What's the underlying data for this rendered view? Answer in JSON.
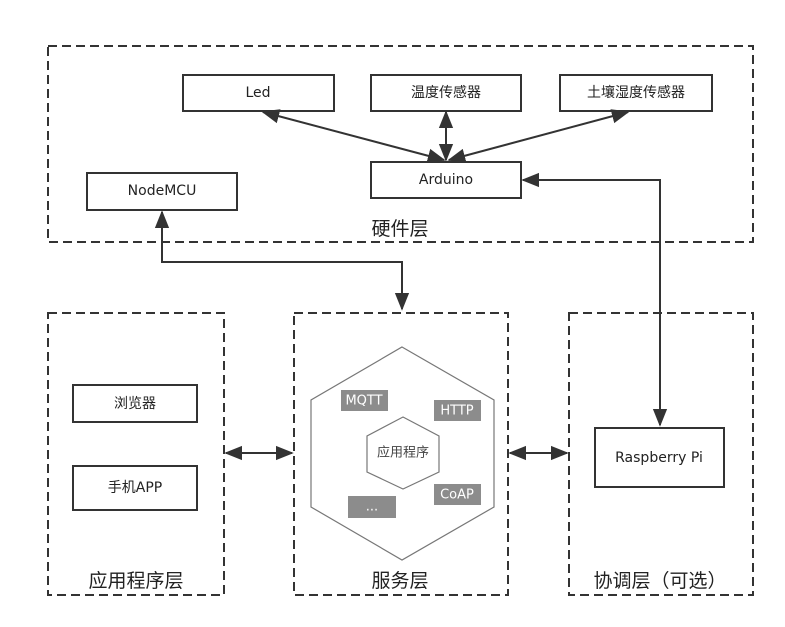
{
  "hardware_layer": {
    "label": "硬件层",
    "nodes": {
      "led": "Led",
      "temp_sensor": "温度传感器",
      "soil_sensor": "土壤湿度传感器",
      "arduino": "Arduino",
      "nodemcu": "NodeMCU"
    }
  },
  "app_layer": {
    "label": "应用程序层",
    "nodes": {
      "browser": "浏览器",
      "phone_app": "手机APP"
    }
  },
  "service_layer": {
    "label": "服务层",
    "core": "应用程序",
    "protocols": {
      "mqtt": "MQTT",
      "http": "HTTP",
      "coap": "CoAP",
      "more": "..."
    }
  },
  "coordination_layer": {
    "label": "协调层（可选）",
    "nodes": {
      "raspberry": "Raspberry Pi"
    }
  }
}
